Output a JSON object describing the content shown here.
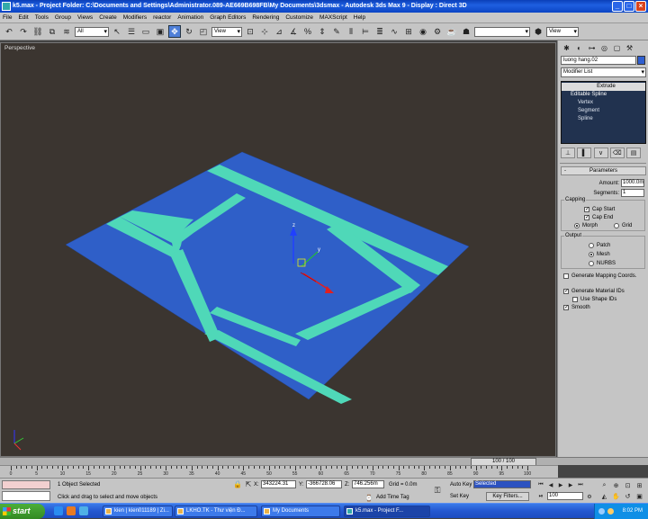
{
  "window": {
    "title": "k5.max - Project Folder: C:\\Documents and Settings\\Administrator.089-AE669B698FB\\My Documents\\3dsmax   - Autodesk 3ds Max 9     - Display : Direct 3D",
    "min": "_",
    "max": "□",
    "close": "×"
  },
  "menu": [
    "File",
    "Edit",
    "Tools",
    "Group",
    "Views",
    "Create",
    "Modifiers",
    "reactor",
    "Animation",
    "Graph Editors",
    "Rendering",
    "Customize",
    "MAXScript",
    "Help"
  ],
  "toolbar": {
    "filter": "All",
    "refcoord": "View",
    "refcoord2": "View",
    "snap_value": "0.00",
    "named_sel": "",
    "icons": [
      "undo-icon",
      "redo-icon",
      "select-link-icon",
      "unlink-icon",
      "bind-space-warp-icon",
      "selection-filter",
      "select-object-icon",
      "select-by-name-icon",
      "rect-selection-icon",
      "window-crossing-icon",
      "move-icon",
      "rotate-icon",
      "scale-icon"
    ]
  },
  "viewport": {
    "label": "Perspective",
    "colors": {
      "background": "#3b3530",
      "plane": "#2f5fc8",
      "road": "#4fd8b8"
    },
    "gizmo": {
      "x": "x",
      "y": "y",
      "z": "z"
    }
  },
  "command_panel": {
    "object_name": "luong hang.02",
    "object_color": "#2f5fd0",
    "modifier_list": "Modifier List",
    "stack": [
      {
        "label": "Extrude",
        "type": "hl"
      },
      {
        "label": "Editable Spline",
        "type": "base"
      },
      {
        "label": "Vertex",
        "type": "sub"
      },
      {
        "label": "Segment",
        "type": "sub"
      },
      {
        "label": "Spline",
        "type": "sub"
      }
    ],
    "parameters": {
      "title": "Parameters",
      "amount_label": "Amount:",
      "amount_value": "1000.0m",
      "segments_label": "Segments:",
      "segments_value": "1",
      "capping_title": "Capping",
      "cap_start": "Cap Start",
      "cap_start_checked": true,
      "cap_end": "Cap End",
      "cap_end_checked": true,
      "morph": "Morph",
      "morph_selected": true,
      "grid": "Grid",
      "output_title": "Output",
      "patch": "Patch",
      "mesh": "Mesh",
      "mesh_selected": true,
      "nurbs": "NURBS",
      "gen_mapping": "Generate Mapping Coords.",
      "gen_mapping_checked": false,
      "gen_material": "Generate Material IDs",
      "gen_material_checked": true,
      "use_shape": "Use Shape IDs",
      "use_shape_checked": false,
      "smooth": "Smooth",
      "smooth_checked": true
    }
  },
  "timeline": {
    "slider": "100 / 100",
    "tick_labels": [
      "0",
      "5",
      "10",
      "15",
      "20",
      "25",
      "30",
      "35",
      "40",
      "45",
      "50",
      "55",
      "60",
      "65",
      "70",
      "75",
      "80",
      "85",
      "90",
      "95",
      "100"
    ]
  },
  "status": {
    "selected": "1 Object Selected",
    "prompt": "Click and drag to select and move objects",
    "x_label": "X:",
    "x_value": "343224.31",
    "y_label": "Y:",
    "y_value": "-366728.06",
    "z_label": "Z:",
    "z_value": "746.256m",
    "grid": "Grid = 0.0m",
    "add_time_tag": "Add Time Tag",
    "auto_key": "Auto Key",
    "set_key": "Set Key",
    "key_mode": "Selected",
    "key_filters": "Key Filters...",
    "frame": "100"
  },
  "taskbar": {
    "start": "start",
    "tasks": [
      "kien | kien011189 | Zi...",
      "LKHO.TK - Thư viện Đ...",
      "My Documents",
      "k5.max",
      "- Project F..."
    ],
    "clock": "8:02 PM"
  }
}
